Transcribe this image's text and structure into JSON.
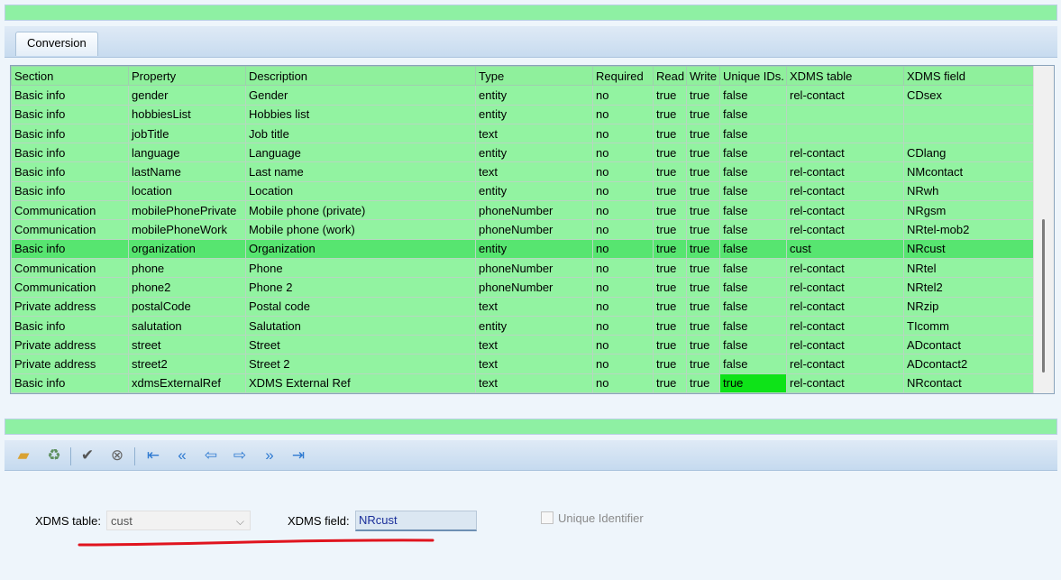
{
  "tabs": {
    "conversion": "Conversion"
  },
  "grid": {
    "headers": [
      "Section",
      "Property",
      "Description",
      "Type",
      "Required",
      "Read",
      "Write",
      "Unique IDs.",
      "XDMS table",
      "XDMS field"
    ],
    "rows": [
      [
        "Basic info",
        "gender",
        "Gender",
        "entity",
        "no",
        "true",
        "true",
        "false",
        "rel-contact",
        "CDsex"
      ],
      [
        "Basic info",
        "hobbiesList",
        "Hobbies list",
        "entity",
        "no",
        "true",
        "true",
        "false",
        "",
        ""
      ],
      [
        "Basic info",
        "jobTitle",
        "Job title",
        "text",
        "no",
        "true",
        "true",
        "false",
        "",
        ""
      ],
      [
        "Basic info",
        "language",
        "Language",
        "entity",
        "no",
        "true",
        "true",
        "false",
        "rel-contact",
        "CDlang"
      ],
      [
        "Basic info",
        "lastName",
        "Last name",
        "text",
        "no",
        "true",
        "true",
        "false",
        "rel-contact",
        "NMcontact"
      ],
      [
        "Basic info",
        "location",
        "Location",
        "entity",
        "no",
        "true",
        "true",
        "false",
        "rel-contact",
        "NRwh"
      ],
      [
        "Communication",
        "mobilePhonePrivate",
        "Mobile phone (private)",
        "phoneNumber",
        "no",
        "true",
        "true",
        "false",
        "rel-contact",
        "NRgsm"
      ],
      [
        "Communication",
        "mobilePhoneWork",
        "Mobile phone (work)",
        "phoneNumber",
        "no",
        "true",
        "true",
        "false",
        "rel-contact",
        "NRtel-mob2"
      ],
      [
        "Basic info",
        "organization",
        "Organization",
        "entity",
        "no",
        "true",
        "true",
        "false",
        "cust",
        "NRcust"
      ],
      [
        "Communication",
        "phone",
        "Phone",
        "phoneNumber",
        "no",
        "true",
        "true",
        "false",
        "rel-contact",
        "NRtel"
      ],
      [
        "Communication",
        "phone2",
        "Phone 2",
        "phoneNumber",
        "no",
        "true",
        "true",
        "false",
        "rel-contact",
        "NRtel2"
      ],
      [
        "Private address",
        "postalCode",
        "Postal code",
        "text",
        "no",
        "true",
        "true",
        "false",
        "rel-contact",
        "NRzip"
      ],
      [
        "Basic info",
        "salutation",
        "Salutation",
        "entity",
        "no",
        "true",
        "true",
        "false",
        "rel-contact",
        "TIcomm"
      ],
      [
        "Private address",
        "street",
        "Street",
        "text",
        "no",
        "true",
        "true",
        "false",
        "rel-contact",
        "ADcontact"
      ],
      [
        "Private address",
        "street2",
        "Street 2",
        "text",
        "no",
        "true",
        "true",
        "false",
        "rel-contact",
        "ADcontact2"
      ],
      [
        "Basic info",
        "xdmsExternalRef",
        "XDMS External Ref",
        "text",
        "no",
        "true",
        "true",
        "true",
        "rel-contact",
        "NRcontact"
      ]
    ],
    "selected_row": 8,
    "highlight": {
      "row": 15,
      "col": 7,
      "color": "#0ee318"
    }
  },
  "toolbar": {
    "icons": [
      "open-folder-icon",
      "recycle-bin-icon",
      "checkmark-icon",
      "cancel-icon",
      "first-record-icon",
      "previous-page-icon",
      "previous-record-icon",
      "next-record-icon",
      "next-page-icon",
      "last-record-icon"
    ]
  },
  "form": {
    "xdms_table_label": "XDMS table:",
    "xdms_table_value": "cust",
    "xdms_field_label": "XDMS field:",
    "xdms_field_value": "NRcust",
    "unique_identifier_label": "Unique Identifier",
    "unique_identifier_checked": false
  },
  "colors": {
    "green_accent": "#8ef0a3",
    "selected_row": "#57e570",
    "annotation": "#e0141e"
  }
}
